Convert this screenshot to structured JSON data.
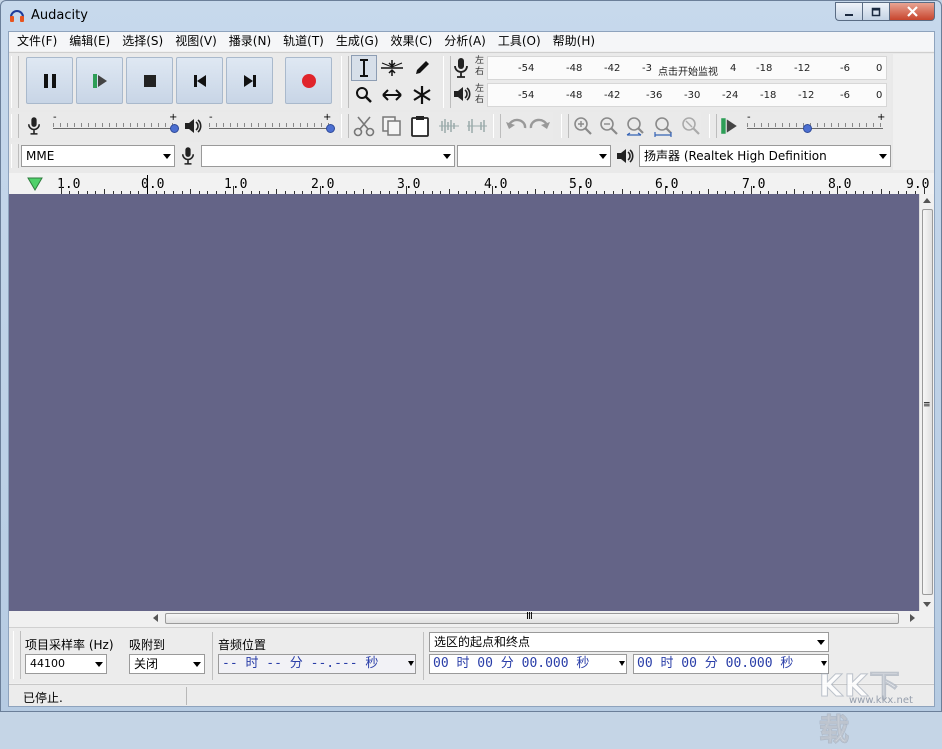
{
  "window": {
    "title": "Audacity",
    "min_label": "0",
    "max_label": "1",
    "close_label": "r"
  },
  "menu": [
    "文件(F)",
    "编辑(E)",
    "选择(S)",
    "视图(V)",
    "播录(N)",
    "轨道(T)",
    "生成(G)",
    "效果(C)",
    "分析(A)",
    "工具(O)",
    "帮助(H)"
  ],
  "meters": {
    "record_lr": [
      "左",
      "右"
    ],
    "play_lr": [
      "左",
      "右"
    ],
    "record_scale": [
      "-54",
      "-48",
      "-42",
      "-3",
      "点击开始监视",
      "4",
      "-18",
      "-12",
      "-6",
      "0"
    ],
    "play_scale": [
      "-54",
      "-48",
      "-42",
      "-36",
      "-30",
      "-24",
      "-18",
      "-12",
      "-6",
      "0"
    ]
  },
  "mixer": {
    "record_volume": 1.0,
    "play_volume": 1.0,
    "minus": "-",
    "plus": "+"
  },
  "play_at_speed": {
    "value": 0.45,
    "minus": "-",
    "plus": "+"
  },
  "device": {
    "host": "MME",
    "recording_device": "",
    "recording_channels": "",
    "playback_device": "扬声器 (Realtek High Definition"
  },
  "ruler": {
    "labels": [
      "1.0",
      "0.0",
      "1.0",
      "2.0",
      "3.0",
      "4.0",
      "5.0",
      "6.0",
      "7.0",
      "8.0",
      "9.0"
    ]
  },
  "hscroll_grip": "Ⅲ",
  "vscroll_grip": "≡",
  "selection_toolbar": {
    "rate_label": "项目采样率 (Hz)",
    "rate_value": "44100",
    "snap_label": "吸附到",
    "snap_value": "关闭",
    "audio_pos_label": "音频位置",
    "audio_pos_value": "-- 时 -- 分 --.--- 秒",
    "selection_mode": "选区的起点和终点",
    "start_value": "00 时 00 分 00.000 秒",
    "end_value": "00 时 00 分 00.000 秒"
  },
  "status": {
    "text": "已停止."
  },
  "watermark": {
    "brand": "KK下载",
    "url": "www.kkx.net"
  },
  "colors": {
    "track_bg": "#646487",
    "record": "#e0242b",
    "play_green": "#2e9e57",
    "knob_blue": "#4c6fd1"
  }
}
